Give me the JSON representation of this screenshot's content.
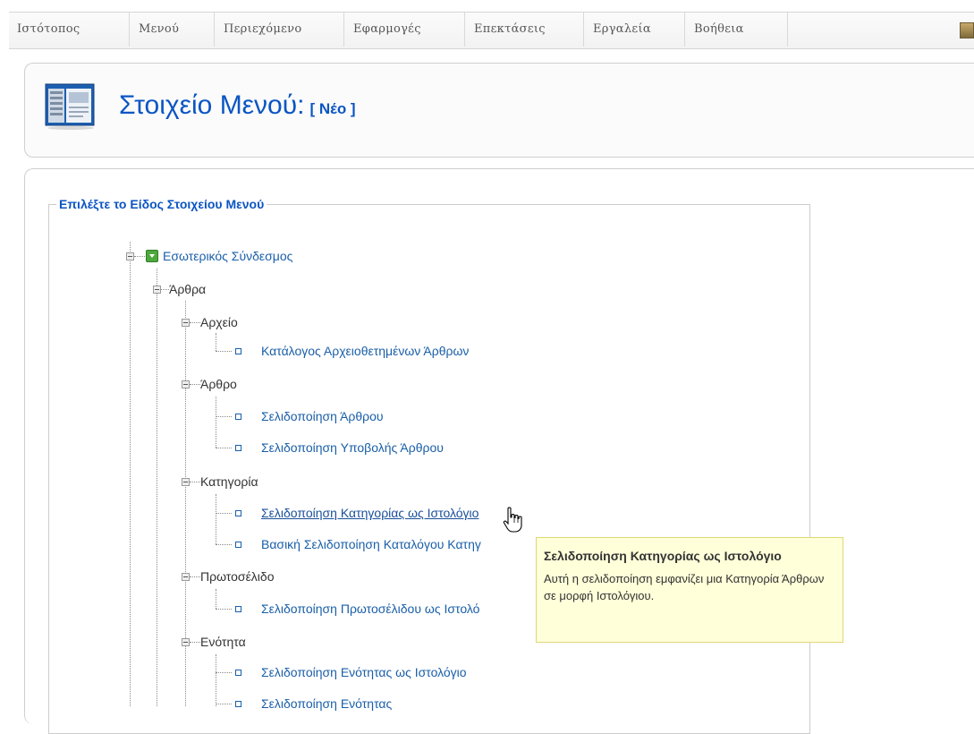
{
  "menu": {
    "items": [
      "Ιστότοπος",
      "Μενού",
      "Περιεχόμενο",
      "Εφαρμογές",
      "Επεκτάσεις",
      "Εργαλεία",
      "Βοήθεια"
    ]
  },
  "header": {
    "title": "Στοιχείο Μενού:",
    "subtitle": "[ Νέο ]",
    "icon": "menu-manager-icon"
  },
  "fieldset": {
    "legend": "Επιλέξτε το Είδος Στοιχείου Μενού"
  },
  "tree": {
    "root": "Εσωτερικός Σύνδεσμος",
    "articles": "Άρθρα",
    "archive": {
      "label": "Αρχείο",
      "items": [
        "Κατάλογος Αρχειοθετημένων Άρθρων"
      ]
    },
    "article": {
      "label": "Άρθρο",
      "items": [
        "Σελιδοποίηση Άρθρου",
        "Σελιδοποίηση Υποβολής Άρθρου"
      ]
    },
    "category": {
      "label": "Κατηγορία",
      "items": [
        "Σελιδοποίηση Κατηγορίας ως Ιστολόγιο",
        "Βασική Σελιδοποίηση Καταλόγου Κατηγ"
      ]
    },
    "frontpage": {
      "label": "Πρωτοσέλιδο",
      "items": [
        "Σελιδοποίηση Πρωτοσέλιδου ως Ιστολό"
      ]
    },
    "section": {
      "label": "Ενότητα",
      "items": [
        "Σελιδοποίηση Ενότητας ως Ιστολόγιο",
        "Σελιδοποίηση Ενότητας"
      ]
    }
  },
  "tooltip": {
    "title": "Σελιδοποίηση Κατηγορίας ως Ιστολόγιο",
    "text": "Αυτή η σελιδοποίηση εμφανίζει μια Κατηγορία Άρθρων σε μορφή Ιστολόγιου."
  },
  "colors": {
    "link": "#1a5fa8",
    "title": "#0b55c4",
    "tooltip_bg": "#ffffd9"
  }
}
